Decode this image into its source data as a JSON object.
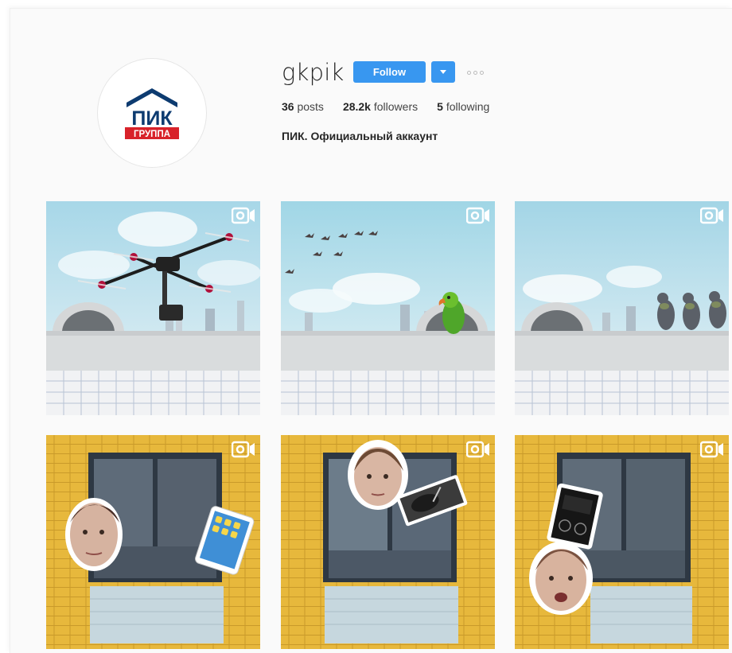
{
  "profile": {
    "username": "gkpik",
    "follow_label": "Follow",
    "full_name": "ПИК. Официальный аккаунт",
    "logo_text_top": "ПИК",
    "logo_text_bottom": "ГРУППА",
    "stats": {
      "posts_count": "36",
      "posts_label": "posts",
      "followers_count": "28.2k",
      "followers_label": "followers",
      "following_count": "5",
      "following_label": "following"
    }
  },
  "colors": {
    "accent": "#3897f0",
    "logo_navy": "#0d3b70",
    "logo_red": "#d8222a",
    "sky_top": "#9fd4e6",
    "brick_yellow": "#e7b83c"
  },
  "posts": [
    {
      "type": "video",
      "icon": "video-camera-icon",
      "scene": "drone-over-rooftop"
    },
    {
      "type": "video",
      "icon": "video-camera-icon",
      "scene": "parrot-and-birds-on-rooftop"
    },
    {
      "type": "video",
      "icon": "video-camera-icon",
      "scene": "pigeons-on-rooftop"
    },
    {
      "type": "video",
      "icon": "video-camera-icon",
      "scene": "window-face-tablet"
    },
    {
      "type": "video",
      "icon": "video-camera-icon",
      "scene": "window-face-turntable"
    },
    {
      "type": "video",
      "icon": "video-camera-icon",
      "scene": "window-face-speaker"
    }
  ]
}
